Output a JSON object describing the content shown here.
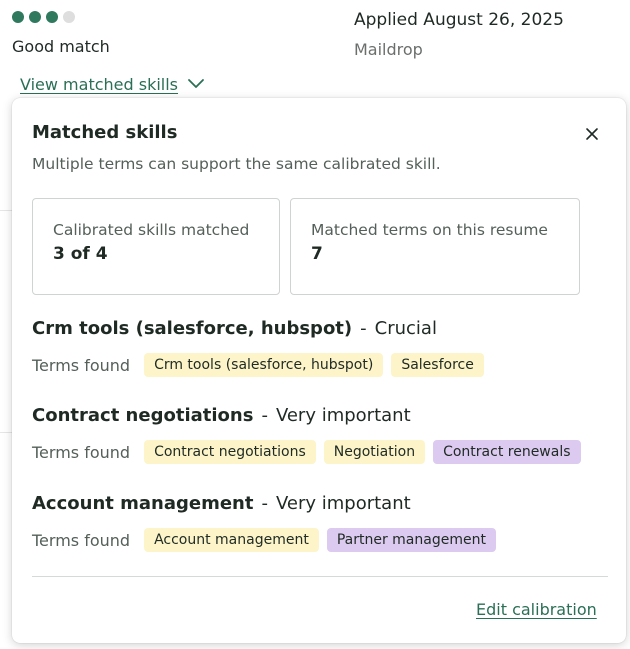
{
  "match": {
    "dots_filled": 3,
    "dots_total": 4,
    "label": "Good match",
    "toggle_label": "View matched skills"
  },
  "application": {
    "applied": "Applied August 26, 2025",
    "source": "Maildrop"
  },
  "popover": {
    "title": "Matched skills",
    "subtitle": "Multiple terms can support the same calibrated skill.",
    "stats": [
      {
        "label": "Calibrated skills matched",
        "value": "3 of 4"
      },
      {
        "label": "Matched terms on this resume",
        "value": "7"
      }
    ],
    "terms_label": "Terms found",
    "skills": [
      {
        "name": "Crm tools (salesforce, hubspot)",
        "separator": "-",
        "importance": "Crucial",
        "terms": [
          {
            "text": "Crm tools (salesforce, hubspot)",
            "kind": "yellow"
          },
          {
            "text": "Salesforce",
            "kind": "yellow"
          }
        ]
      },
      {
        "name": "Contract negotiations",
        "separator": "-",
        "importance": "Very important",
        "terms": [
          {
            "text": "Contract negotiations",
            "kind": "yellow"
          },
          {
            "text": "Negotiation",
            "kind": "yellow"
          },
          {
            "text": "Contract renewals",
            "kind": "purple"
          }
        ]
      },
      {
        "name": "Account management",
        "separator": "-",
        "importance": "Very important",
        "terms": [
          {
            "text": "Account management",
            "kind": "yellow"
          },
          {
            "text": "Partner management",
            "kind": "purple"
          }
        ]
      }
    ],
    "edit_label": "Edit calibration"
  },
  "colors": {
    "accent_green": "#2a6f56",
    "dot_green": "#2f7a5f",
    "tag_yellow": "#fdf5c9",
    "tag_purple": "#dccaf0"
  },
  "icons": {
    "toggle": "chevron-down-icon",
    "close": "close-icon"
  }
}
